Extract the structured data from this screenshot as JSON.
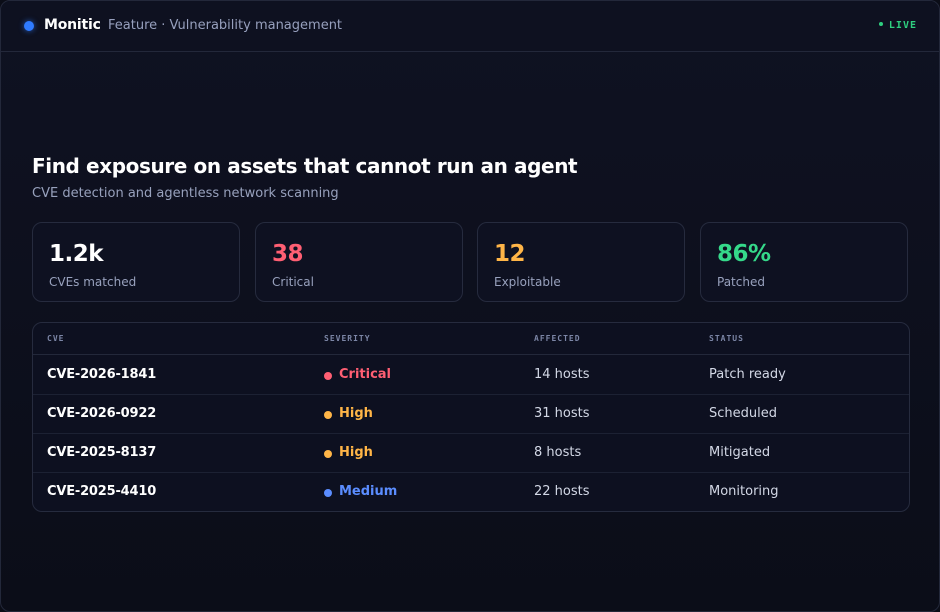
{
  "header": {
    "brand": "Monitic",
    "breadcrumb": "Feature · Vulnerability management",
    "live_label": "LIVE",
    "colors": {
      "logo": "#2f7bff",
      "live": "#2ecf7f"
    }
  },
  "hero": {
    "title": "Find exposure on assets that cannot run an agent",
    "subtitle": "CVE detection and agentless network scanning"
  },
  "stats": [
    {
      "value": "1.2k",
      "label": "CVEs matched",
      "color": "#ffffff"
    },
    {
      "value": "38",
      "label": "Critical",
      "color": "#ff5f73"
    },
    {
      "value": "12",
      "label": "Exploitable",
      "color": "#ffb547"
    },
    {
      "value": "86%",
      "label": "Patched",
      "color": "#35d98a"
    }
  ],
  "table": {
    "headers": [
      "CVE",
      "SEVERITY",
      "AFFECTED",
      "STATUS"
    ],
    "rows": [
      {
        "cve": "CVE-2026-1841",
        "severity": "Critical",
        "severity_color": "#ff5f73",
        "affected": "14 hosts",
        "status": "Patch ready"
      },
      {
        "cve": "CVE-2026-0922",
        "severity": "High",
        "severity_color": "#ffb547",
        "affected": "31 hosts",
        "status": "Scheduled"
      },
      {
        "cve": "CVE-2025-8137",
        "severity": "High",
        "severity_color": "#ffb547",
        "affected": "8 hosts",
        "status": "Mitigated"
      },
      {
        "cve": "CVE-2025-4410",
        "severity": "Medium",
        "severity_color": "#5b8dff",
        "affected": "22 hosts",
        "status": "Monitoring"
      }
    ]
  }
}
